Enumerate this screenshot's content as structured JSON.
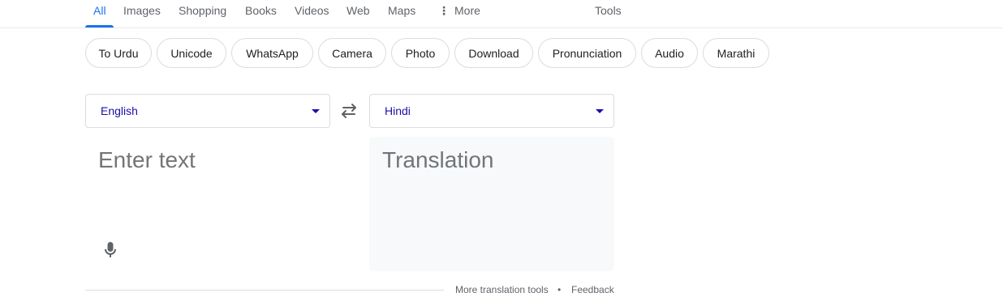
{
  "nav": {
    "tabs": [
      {
        "label": "All",
        "active": true
      },
      {
        "label": "Images"
      },
      {
        "label": "Shopping"
      },
      {
        "label": "Books"
      },
      {
        "label": "Videos"
      },
      {
        "label": "Web"
      },
      {
        "label": "Maps"
      },
      {
        "label": "More",
        "icon": "more-vert-icon"
      }
    ],
    "tools": "Tools"
  },
  "chips": [
    "To Urdu",
    "Unicode",
    "WhatsApp",
    "Camera",
    "Photo",
    "Download",
    "Pronunciation",
    "Audio",
    "Marathi"
  ],
  "translator": {
    "source_language": "English",
    "target_language": "Hindi",
    "source_placeholder": "Enter text",
    "target_placeholder": "Translation",
    "icons": {
      "swap": "swap-icon",
      "mic": "microphone-icon",
      "dropdown": "caret-down-icon"
    }
  },
  "footer": {
    "more_tools": "More translation tools",
    "separator": "•",
    "feedback": "Feedback"
  },
  "colors": {
    "accent": "#1a73e8",
    "language_link": "#1a0dab",
    "muted": "#5f6368",
    "border": "#dadce0",
    "panel_bg": "#f8f9fa"
  }
}
